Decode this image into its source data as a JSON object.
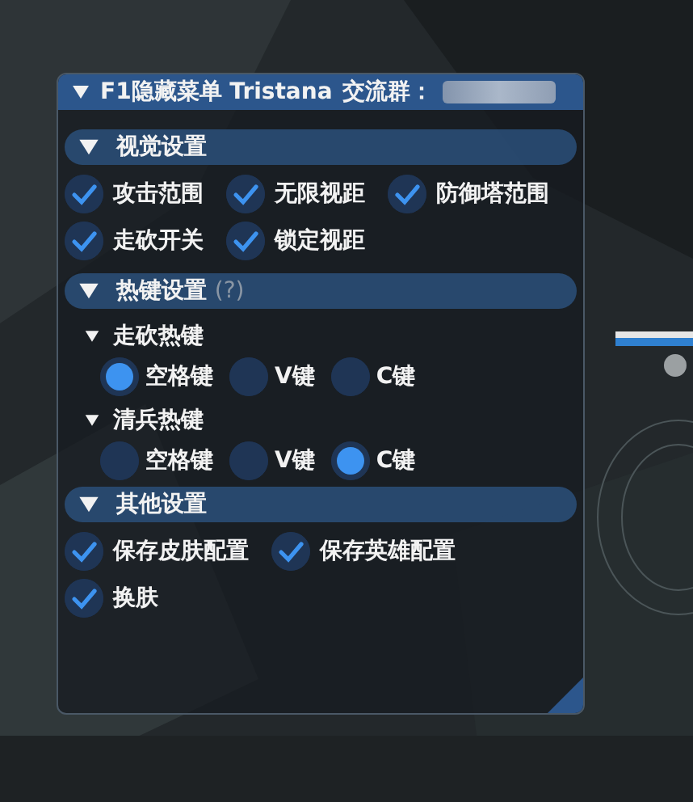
{
  "window": {
    "title": "F1隐藏菜单 Tristana",
    "group_label": "交流群：",
    "expanded": true
  },
  "sections": [
    {
      "title": "视觉设置",
      "expanded": true,
      "items": [
        {
          "label": "攻击范围",
          "checked": true
        },
        {
          "label": "无限视距",
          "checked": true
        },
        {
          "label": "防御塔范围",
          "checked": true
        },
        {
          "label": "走砍开关",
          "checked": true
        },
        {
          "label": "锁定视距",
          "checked": true
        }
      ]
    },
    {
      "title": "热键设置",
      "hint": "(?)",
      "expanded": true,
      "groups": [
        {
          "title": "走砍热键",
          "expanded": true,
          "options": [
            {
              "label": "空格键",
              "selected": true
            },
            {
              "label": "V键",
              "selected": false
            },
            {
              "label": "C键",
              "selected": false
            }
          ]
        },
        {
          "title": "清兵热键",
          "expanded": true,
          "options": [
            {
              "label": "空格键",
              "selected": false
            },
            {
              "label": "V键",
              "selected": false
            },
            {
              "label": "C键",
              "selected": true
            }
          ]
        }
      ]
    },
    {
      "title": "其他设置",
      "expanded": true,
      "items": [
        {
          "label": "保存皮肤配置",
          "checked": true
        },
        {
          "label": "保存英雄配置",
          "checked": true
        },
        {
          "label": "换肤",
          "checked": true
        }
      ]
    }
  ]
}
